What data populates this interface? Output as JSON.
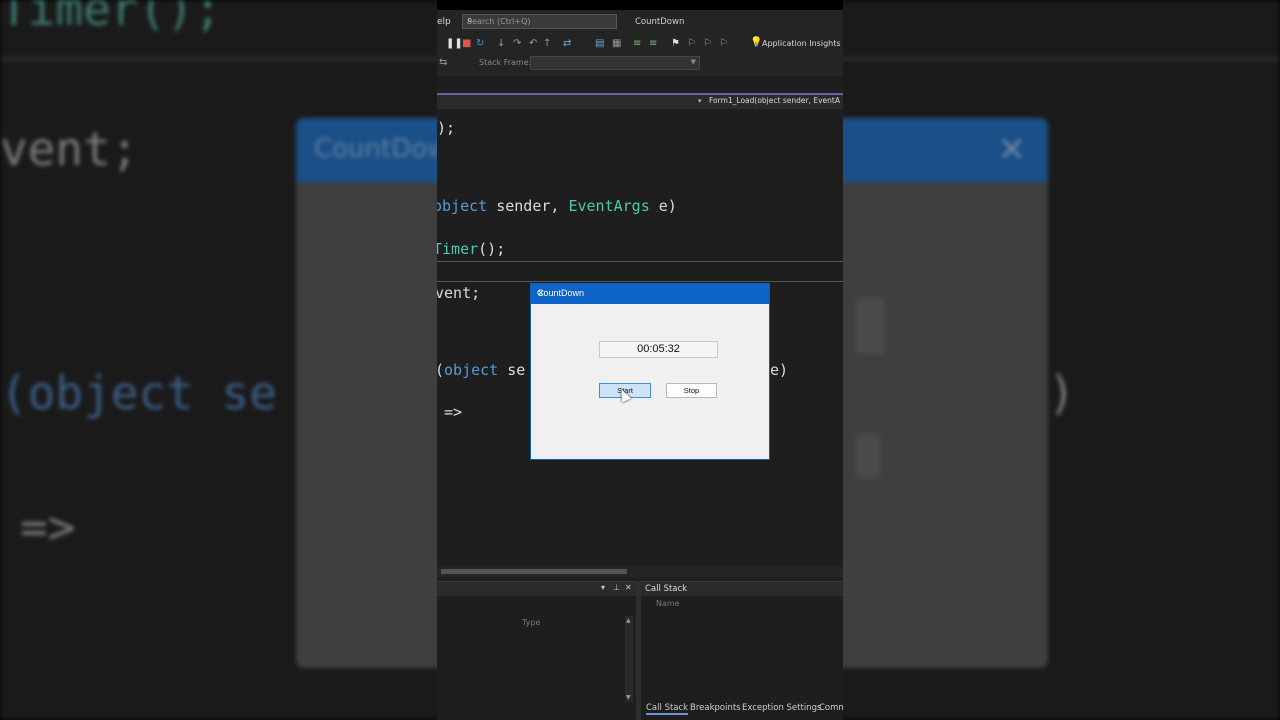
{
  "background": {
    "code_lines": [
      "Timer();",
      "vent;",
      "(object se",
      "e)",
      "=>"
    ],
    "dialog_title": "CountDown",
    "close_glyph": "✕"
  },
  "ide": {
    "menu_help": "elp",
    "search_placeholder": "Search (Ctrl+Q)",
    "solution_title": "CountDown",
    "toolbar": {
      "icons": [
        "pause-icon",
        "stop-icon",
        "restart-icon",
        "step-icons",
        "bookmark-icons"
      ],
      "app_insights_label": "Application Insights"
    },
    "stack_frame_label": "Stack Frame:",
    "method_nav": "Form1_Load(object sender, EventA",
    "code": [
      {
        "pre": ");",
        "kw": "",
        "ty": "",
        "post": ""
      },
      {
        "pre": "",
        "kw": "object",
        "ty": "",
        "post": " sender, ",
        "ty2": "EventArgs",
        "post2": " e)"
      },
      {
        "pre": "",
        "kw": "",
        "ty": "Timer",
        "post": "();"
      },
      {
        "pre": "vent;",
        "kw": "",
        "ty": "",
        "post": ""
      },
      {
        "pre": "(",
        "kw": "object",
        "post": " se",
        "tail": "e)"
      },
      {
        "pre": " =>"
      }
    ],
    "locals_panel": {
      "type_column": "Type"
    },
    "callstack_panel": {
      "title": "Call Stack",
      "name_column": "Name",
      "tabs": [
        "Call Stack",
        "Breakpoints",
        "Exception Settings",
        "Comm"
      ]
    }
  },
  "dialog": {
    "title": "CountDown",
    "close_glyph": "✕",
    "timer_value": "00:05:32",
    "start_label": "Start",
    "stop_label": "Stop"
  }
}
